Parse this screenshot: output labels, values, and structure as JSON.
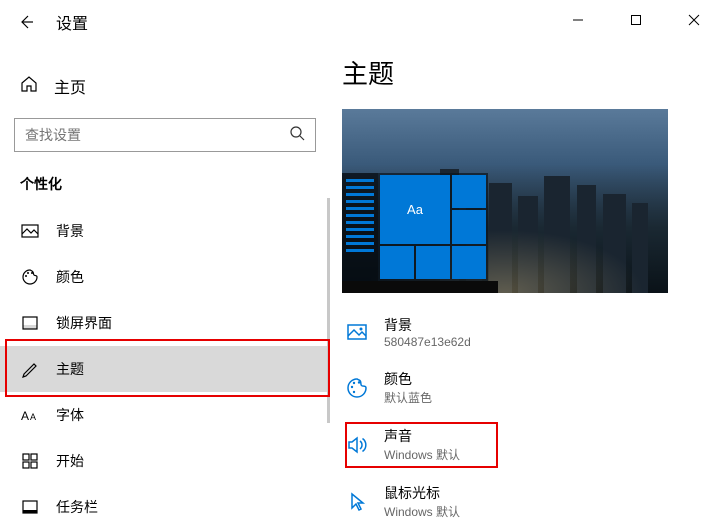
{
  "window": {
    "title": "设置"
  },
  "sidebar": {
    "home": "主页",
    "search_placeholder": "查找设置",
    "section": "个性化",
    "items": [
      {
        "label": "背景"
      },
      {
        "label": "颜色"
      },
      {
        "label": "锁屏界面"
      },
      {
        "label": "主题"
      },
      {
        "label": "字体"
      },
      {
        "label": "开始"
      },
      {
        "label": "任务栏"
      }
    ]
  },
  "main": {
    "heading": "主题",
    "preview_tile_text": "Aa",
    "options": {
      "background": {
        "title": "背景",
        "subtitle": "580487e13e62d"
      },
      "color": {
        "title": "颜色",
        "subtitle": "默认蓝色"
      },
      "sound": {
        "title": "声音",
        "subtitle": "Windows 默认"
      },
      "cursor": {
        "title": "鼠标光标",
        "subtitle": "Windows 默认"
      }
    }
  }
}
